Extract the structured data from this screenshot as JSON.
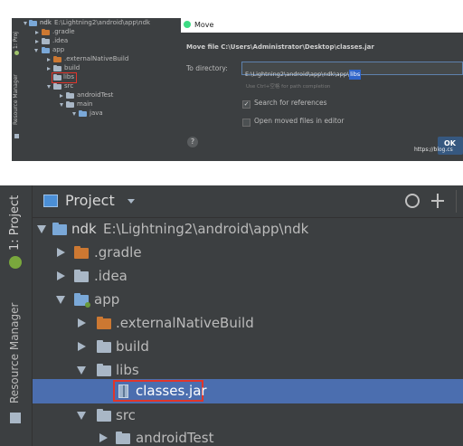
{
  "top_tree": {
    "strip_label": "1: Proj",
    "strip_label_2": "Resource Manager",
    "root_name": "ndk",
    "root_path": "E:\\Lightning2\\android\\app\\ndk",
    "items": [
      ".gradle",
      ".idea",
      "app",
      ".externalNativeBuild",
      "build",
      "libs",
      "src",
      "androidTest",
      "main",
      "java"
    ]
  },
  "move_dialog": {
    "window_title": "Move",
    "heading": "Move file C:\\Users\\Administrator\\Desktop\\classes.jar",
    "to_directory_label": "To directory:",
    "directory_value": "E:\\Lightning2\\android\\app\\ndk\\app\\",
    "directory_highlight": "libs",
    "hint": "Use Ctrl+空格 for path completion",
    "search_references_label": "Search for references",
    "search_references_checked": true,
    "open_moved_label": "Open moved files in editor",
    "open_moved_checked": false,
    "ok_label": "OK",
    "watermark": "https://blog.cs"
  },
  "project_panel": {
    "side_tab_project": "1: Project",
    "side_tab_resources": "Resource Manager",
    "header_title": "Project",
    "tree": {
      "root_name": "ndk",
      "root_path": "E:\\Lightning2\\android\\app\\ndk",
      "gradle": ".gradle",
      "idea": ".idea",
      "app": "app",
      "external_native_build": ".externalNativeBuild",
      "build": "build",
      "libs": "libs",
      "classes_jar": "classes.jar",
      "src": "src",
      "android_test": "androidTest"
    }
  },
  "colors": {
    "panel_bg": "#3c3f41",
    "selection": "#4b6eaf",
    "text": "#bbbbbb",
    "highlight_box": "#e0352b",
    "folder_orange": "#cc7832",
    "folder_gray": "#a9b7c6"
  }
}
